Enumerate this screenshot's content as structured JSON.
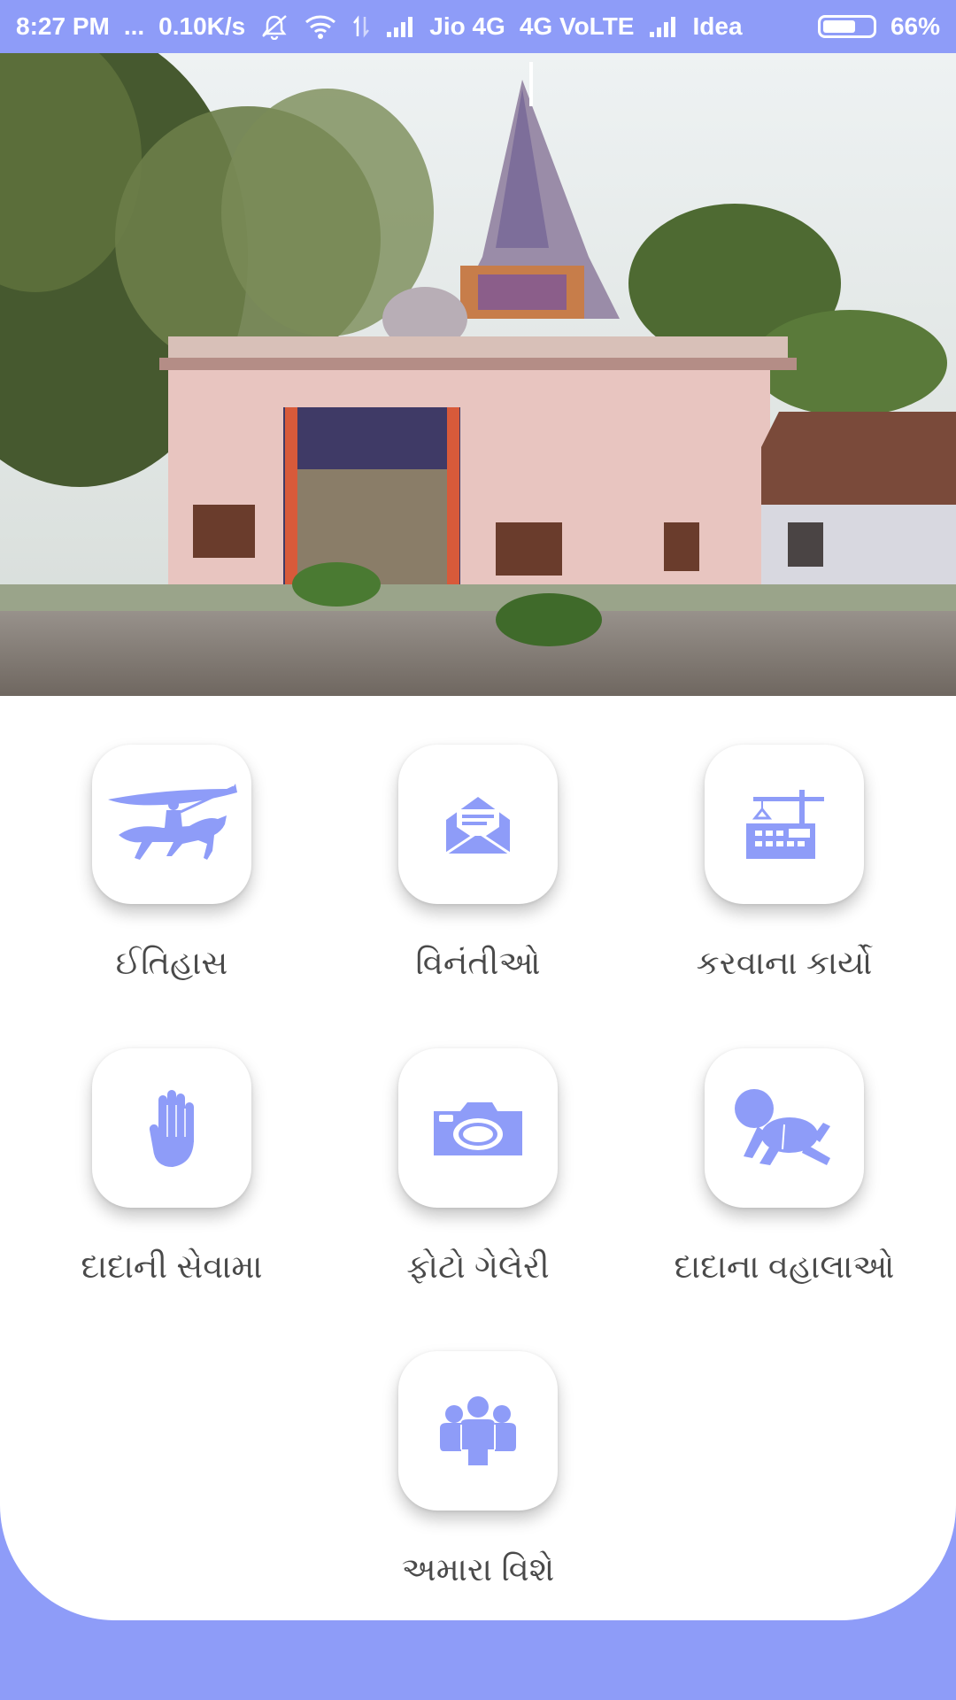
{
  "status_bar": {
    "time": "8:27 PM",
    "dots": "...",
    "speed": "0.10K/s",
    "carrier1": "Jio 4G",
    "network": "4G VoLTE",
    "carrier2": "Idea",
    "battery_percent": "66%",
    "battery_level": 0.66,
    "icons": [
      "mute-icon",
      "wifi-icon",
      "data-arrows-icon",
      "signal-icon",
      "signal-icon",
      "battery-icon"
    ]
  },
  "hero": {
    "image": "temple-photo"
  },
  "menu": {
    "items": [
      {
        "label": "ઈતિહાસ",
        "icon": "horse-rider-icon"
      },
      {
        "label": "વિનંતીઓ",
        "icon": "envelope-icon"
      },
      {
        "label": "કરવાના કાર્યો",
        "icon": "construction-icon"
      },
      {
        "label": "દાદાની સેવામા",
        "icon": "hand-icon"
      },
      {
        "label": "ફોટો ગેલેરી",
        "icon": "camera-icon"
      },
      {
        "label": "દાદાના વહાલાઓ",
        "icon": "baby-icon"
      },
      {
        "label": "અમારા વિશે",
        "icon": "group-icon"
      }
    ]
  },
  "colors": {
    "accent": "#8e9cf8",
    "icon": "#8e9cf8",
    "label": "#4a4a4a",
    "background": "#ffffff"
  }
}
